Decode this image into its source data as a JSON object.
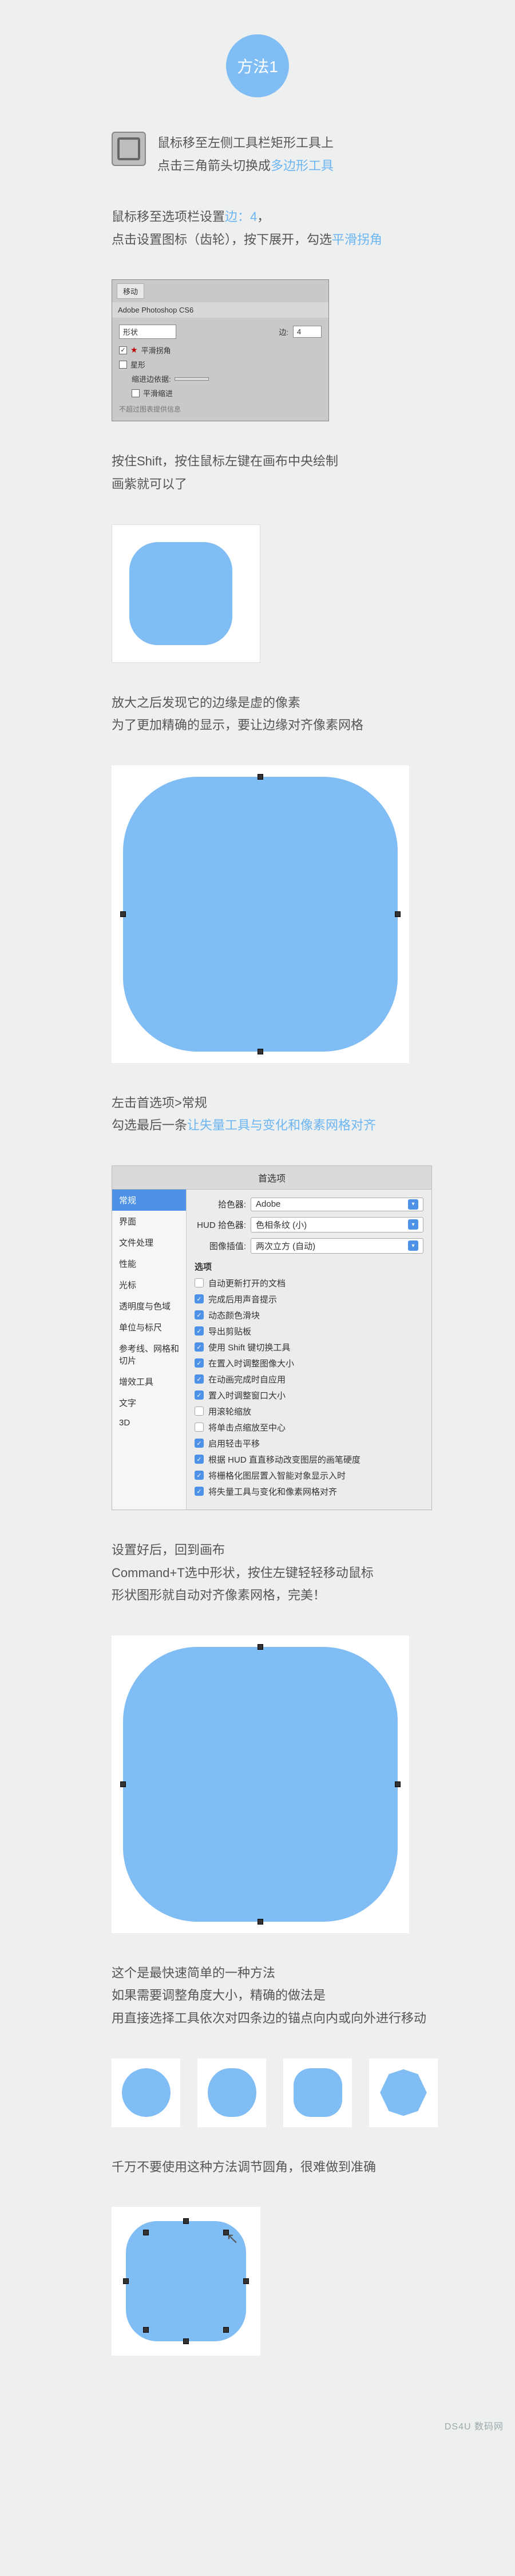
{
  "badge": "方法1",
  "intro": {
    "line1": "鼠标移至左侧工具栏矩形工具上",
    "line2a": "点击三角箭头切换成",
    "line2b": "多边形工具"
  },
  "step1": {
    "line1a": "鼠标移至选项栏设置",
    "line1b": "边：4",
    "line1c": "，",
    "line2a": "点击设置图标（齿轮），按下展开，勾选",
    "line2b": "平滑拐角"
  },
  "ps": {
    "tab": "移动",
    "title": "Adobe Photoshop CS6",
    "edges_label": "边:",
    "edges_value": "4",
    "sel1": "形状",
    "smooth": "平滑拐角",
    "star": "星形",
    "indent_label": "缩进边依据:",
    "indent_value": "",
    "smooth_indent": "平滑缩进",
    "info": "不超过图表提供信息"
  },
  "step2": {
    "line1": "按住Shift，按住鼠标左键在画布中央绘制",
    "line2": "画紫就可以了"
  },
  "step3": {
    "line1": "放大之后发现它的边缘是虚的像素",
    "line2": "为了更加精确的显示，要让边缘对齐像素网格"
  },
  "step4": {
    "line1": "左击首选项>常规",
    "line2a": "勾选最后一条",
    "line2b": "让失量工具与变化和像素网格对齐"
  },
  "pref": {
    "title": "首选项",
    "side": [
      "常规",
      "界面",
      "文件处理",
      "性能",
      "光标",
      "透明度与色域",
      "单位与标尺",
      "参考线、网格和切片",
      "增效工具",
      "文字",
      "3D"
    ],
    "c_picker_lbl": "拾色器:",
    "c_picker": "Adobe",
    "hud_lbl": "HUD 拾色器:",
    "hud": "色相条纹 (小)",
    "interp_lbl": "图像插值:",
    "interp": "两次立方 (自动)",
    "section": "选项",
    "checks": [
      {
        "label": "自动更新打开的文档",
        "on": false
      },
      {
        "label": "完成后用声音提示",
        "on": true
      },
      {
        "label": "动态颜色滑块",
        "on": true
      },
      {
        "label": "导出剪贴板",
        "on": true
      },
      {
        "label": "使用 Shift 键切换工具",
        "on": true
      },
      {
        "label": "在置入时调整图像大小",
        "on": true
      },
      {
        "label": "在动画完成时自应用",
        "on": true
      },
      {
        "label": "置入时调整窗口大小",
        "on": true
      },
      {
        "label": "用滚轮缩放",
        "on": false
      },
      {
        "label": "将单击点缩放至中心",
        "on": false
      },
      {
        "label": "启用轻击平移",
        "on": true
      },
      {
        "label": "根据 HUD 直直移动改变图层的画笔硬度",
        "on": true
      },
      {
        "label": "将栅格化图层置入智能对象显示入时",
        "on": true
      },
      {
        "label": "将失量工具与变化和像素网格对齐",
        "on": true
      }
    ]
  },
  "step5": {
    "line1": "设置好后，回到画布",
    "line2": "Command+T选中形状，按住左键轻轻移动鼠标",
    "line3": "形状图形就自动对齐像素网格，完美！"
  },
  "step6": {
    "line1": "这个是最快速简单的一种方法",
    "line2": "如果需要调整角度大小，精确的做法是",
    "line3": "用直接选择工具依次对四条边的锚点向内或向外进行移动"
  },
  "step7": {
    "line1": "千万不要使用这种方法调节圆角，很难做到准确"
  },
  "watermark": "DS4U 数码网"
}
